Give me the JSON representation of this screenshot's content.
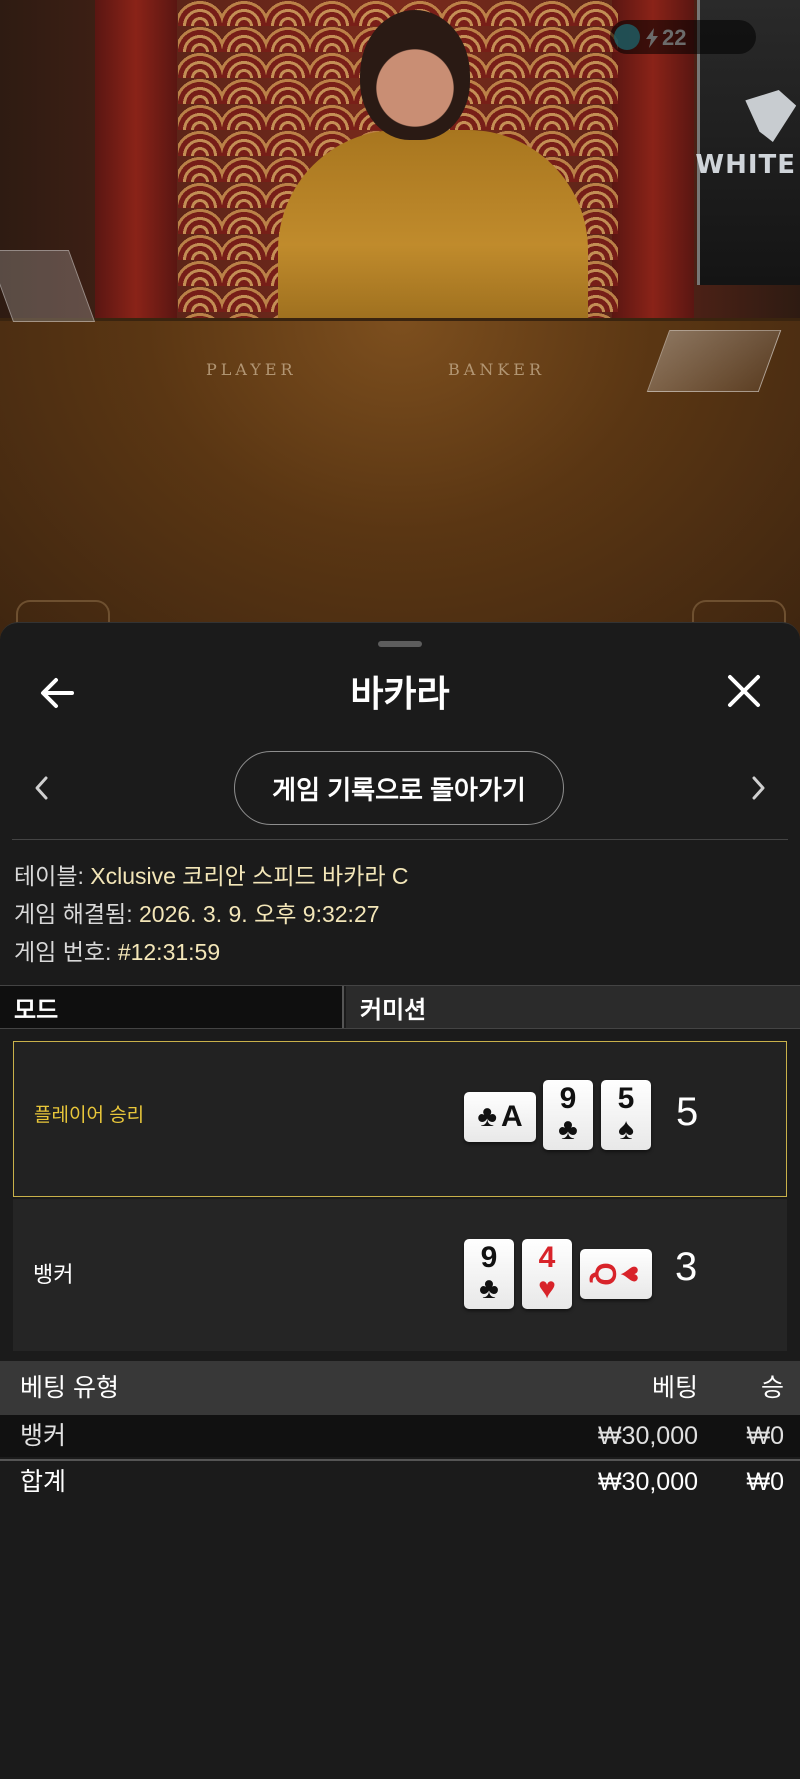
{
  "video": {
    "counter_value": "22",
    "table_player_label": "PLAYER",
    "table_banker_label": "BANKER",
    "screen_logo": "WHITE"
  },
  "header": {
    "title": "바카라"
  },
  "nav": {
    "history_button": "게임 기록으로 돌아가기"
  },
  "info": {
    "table_label": "테이블: ",
    "table_value": "Xclusive 코리안 스피드 바카라 C",
    "resolved_label": "게임 해결됨: ",
    "resolved_value": "2026. 3. 9. 오후 9:32:27",
    "game_no_label": "게임 번호: ",
    "game_no_value": "#12:31:59"
  },
  "tabs": {
    "mode": "모드",
    "commission": "커미션"
  },
  "results": {
    "player": {
      "label": "플레이어 승리",
      "score": "5",
      "cards": [
        {
          "rank": "A",
          "suit": "♣",
          "color": "black",
          "sideways": true
        },
        {
          "rank": "9",
          "suit": "♣",
          "color": "black",
          "sideways": false
        },
        {
          "rank": "5",
          "suit": "♠",
          "color": "black",
          "sideways": false
        }
      ]
    },
    "banker": {
      "label": "뱅커",
      "score": "3",
      "cards": [
        {
          "rank": "9",
          "suit": "♣",
          "color": "black",
          "sideways": false
        },
        {
          "rank": "4",
          "suit": "♥",
          "color": "red",
          "sideways": false
        },
        {
          "rank": "Q",
          "suit": "♥",
          "color": "red",
          "sideways": true
        }
      ]
    }
  },
  "bets": {
    "headers": {
      "type": "베팅 유형",
      "bet": "베팅",
      "win": "승"
    },
    "rows": [
      {
        "type": "뱅커",
        "bet": "₩30,000",
        "win": "₩0"
      }
    ],
    "total": {
      "type": "합계",
      "bet": "₩30,000",
      "win": "₩0"
    }
  },
  "colors": {
    "accent_gold": "#e8c63a",
    "info_value": "#f3e6b8",
    "sheet_bg": "#1b1b1b"
  }
}
